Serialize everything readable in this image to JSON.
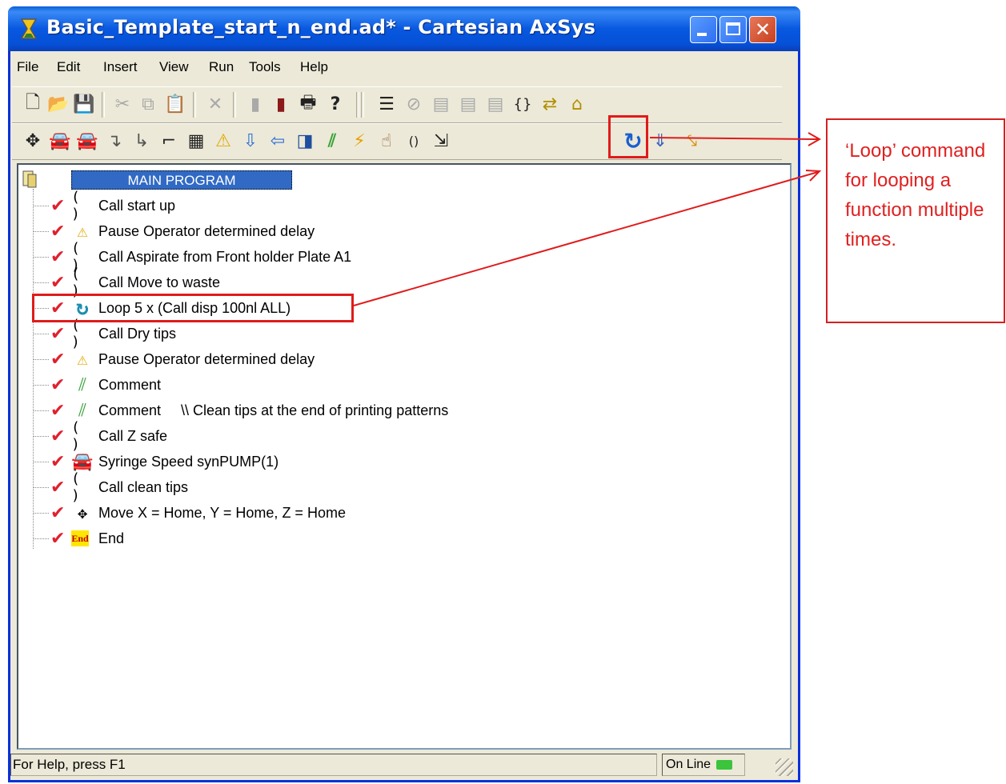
{
  "window": {
    "title": "Basic_Template_start_n_end.ad* - Cartesian AxSys",
    "close_glyph": "✕"
  },
  "menu": [
    "File",
    "Edit",
    "Insert",
    "View",
    "Run",
    "Tools",
    "Help"
  ],
  "toolbar1": [
    {
      "icon": "new-document-icon",
      "glyph": "🗋"
    },
    {
      "icon": "open-folder-icon",
      "glyph": "📂"
    },
    {
      "icon": "save-icon",
      "glyph": "💾"
    },
    {
      "icon": "cut-icon",
      "glyph": "✂"
    },
    {
      "icon": "copy-icon",
      "glyph": "⧉"
    },
    {
      "icon": "paste-icon",
      "glyph": "📋"
    },
    {
      "icon": "delete-icon",
      "glyph": "✕"
    },
    {
      "icon": "insert-sub-icon",
      "glyph": "▮"
    },
    {
      "icon": "insert-sub-color-icon",
      "glyph": "▮"
    },
    {
      "icon": "print-icon",
      "glyph": "🖶"
    },
    {
      "icon": "help-icon",
      "glyph": "?"
    },
    {
      "icon": "run-list-icon",
      "glyph": "☰"
    },
    {
      "icon": "stop-icon",
      "glyph": "⊘"
    },
    {
      "icon": "doc-1-icon",
      "glyph": "▤"
    },
    {
      "icon": "doc-2-icon",
      "glyph": "▤"
    },
    {
      "icon": "doc-3-icon",
      "glyph": "▤"
    },
    {
      "icon": "braces-icon",
      "glyph": "{}"
    },
    {
      "icon": "swap-icon",
      "glyph": "⇄"
    },
    {
      "icon": "home-icon",
      "glyph": "⌂"
    }
  ],
  "toolbar2": [
    {
      "icon": "move-icon",
      "glyph": "✥"
    },
    {
      "icon": "red-car-icon",
      "glyph": "🚘"
    },
    {
      "icon": "green-car-icon",
      "glyph": "🚘"
    },
    {
      "icon": "aspirate-icon",
      "glyph": "↴"
    },
    {
      "icon": "dispense-icon",
      "glyph": "↳"
    },
    {
      "icon": "step-icon",
      "glyph": "⌐"
    },
    {
      "icon": "table-icon",
      "glyph": "▦"
    },
    {
      "icon": "warning-icon",
      "glyph": "⚠"
    },
    {
      "icon": "arrow-down-icon",
      "glyph": "⇩"
    },
    {
      "icon": "arrow-left-icon",
      "glyph": "⇦"
    },
    {
      "icon": "cube-icon",
      "glyph": "◨"
    },
    {
      "icon": "comment-icon",
      "glyph": "⫽"
    },
    {
      "icon": "lightning-icon",
      "glyph": "⚡"
    },
    {
      "icon": "hand-icon",
      "glyph": "☝"
    },
    {
      "icon": "call-icon",
      "glyph": "()"
    },
    {
      "icon": "subroutine-icon",
      "glyph": "⇲"
    },
    {
      "icon": "loop-icon",
      "glyph": "↻"
    },
    {
      "icon": "down-arrow-icon",
      "glyph": "⇓"
    },
    {
      "icon": "marker-icon",
      "glyph": "⤥"
    }
  ],
  "tree": {
    "root_label": "MAIN PROGRAM",
    "check_glyph": "✔",
    "items": [
      {
        "icon": "call",
        "glyph": "( )",
        "text": "Call start up"
      },
      {
        "icon": "warning",
        "glyph": "⚠",
        "text": "Pause Operator determined delay"
      },
      {
        "icon": "call",
        "glyph": "( )",
        "text": "Call Aspirate from Front holder Plate A1"
      },
      {
        "icon": "call",
        "glyph": "( )",
        "text": "Call Move to waste"
      },
      {
        "icon": "loop",
        "glyph": "↻",
        "text": "Loop 5 x (Call disp 100nl ALL)"
      },
      {
        "icon": "call",
        "glyph": "( )",
        "text": "Call Dry tips"
      },
      {
        "icon": "warning",
        "glyph": "⚠",
        "text": "Pause Operator determined delay"
      },
      {
        "icon": "comment",
        "glyph": "⫽",
        "text": "Comment"
      },
      {
        "icon": "comment",
        "glyph": "⫽",
        "text": "Comment     \\\\ Clean tips at the end of printing patterns"
      },
      {
        "icon": "call",
        "glyph": "( )",
        "text": "Call Z safe"
      },
      {
        "icon": "car",
        "glyph": "🚘",
        "text": "Syringe Speed synPUMP(1)"
      },
      {
        "icon": "call",
        "glyph": "( )",
        "text": "Call clean tips"
      },
      {
        "icon": "move",
        "glyph": "✥",
        "text": "Move X = Home, Y = Home, Z = Home"
      },
      {
        "icon": "end",
        "glyph": "End",
        "text": "End"
      }
    ]
  },
  "status": {
    "help": "For Help, press F1",
    "online": "On Line"
  },
  "annotation": {
    "callout": "‘Loop’ command for looping a function multiple times."
  },
  "colors": {
    "annotation_red": "#e01b1b",
    "titlebar_blue": "#0858e0",
    "selection_blue": "#316ac5"
  }
}
